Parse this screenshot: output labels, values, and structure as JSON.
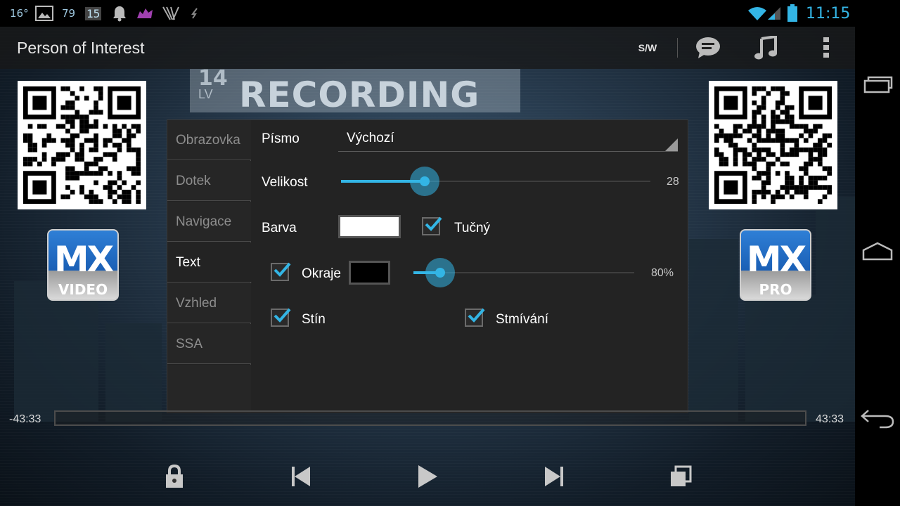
{
  "status_bar": {
    "temperature": "16°",
    "left_num_1": "79",
    "left_num_2": "15",
    "clock": "11:15"
  },
  "action_bar": {
    "title": "Person of Interest",
    "sw_label": "S/W"
  },
  "video_overlay": {
    "recording_text": "RECORDING",
    "recording_number": "14",
    "recording_lv": "LV"
  },
  "logos": {
    "left_big": "MX",
    "left_sub": "VIDEO",
    "right_big": "MX",
    "right_sub": "PRO"
  },
  "dialog": {
    "tabs": [
      {
        "label": "Obrazovka",
        "active": false
      },
      {
        "label": "Dotek",
        "active": false
      },
      {
        "label": "Navigace",
        "active": false
      },
      {
        "label": "Text",
        "active": true
      },
      {
        "label": "Vzhled",
        "active": false
      },
      {
        "label": "SSA",
        "active": false
      }
    ],
    "font_label": "Písmo",
    "font_value": "Výchozí",
    "size_label": "Velikost",
    "size_value": "28",
    "size_fraction": 0.27,
    "color_label": "Barva",
    "color_value": "#ffffff",
    "bold_label": "Tučný",
    "bold_checked": true,
    "border_label": "Okraje",
    "border_checked": true,
    "border_color": "#000000",
    "border_opacity_value": "80%",
    "border_fraction": 0.12,
    "shadow_label": "Stín",
    "shadow_checked": true,
    "fade_label": "Stmívání",
    "fade_checked": true
  },
  "playback": {
    "time_remaining": "-43:33",
    "time_total": "43:33",
    "progress": 0
  },
  "colors": {
    "accent": "#33b5e5",
    "status_clock": "#34b5e5"
  },
  "icons": {
    "status": [
      "photo-icon",
      "notification-bell-icon",
      "app-icon",
      "rss-icon",
      "wifi-icon",
      "signal-icon",
      "battery-icon"
    ],
    "action_bar": [
      "subtitle-icon",
      "music-note-icon",
      "overflow-menu-icon"
    ],
    "controls": [
      "lock-icon",
      "skip-previous-icon",
      "play-icon",
      "skip-next-icon",
      "aspect-ratio-icon"
    ],
    "nav": [
      "recent-apps-icon",
      "home-icon",
      "back-icon"
    ]
  }
}
